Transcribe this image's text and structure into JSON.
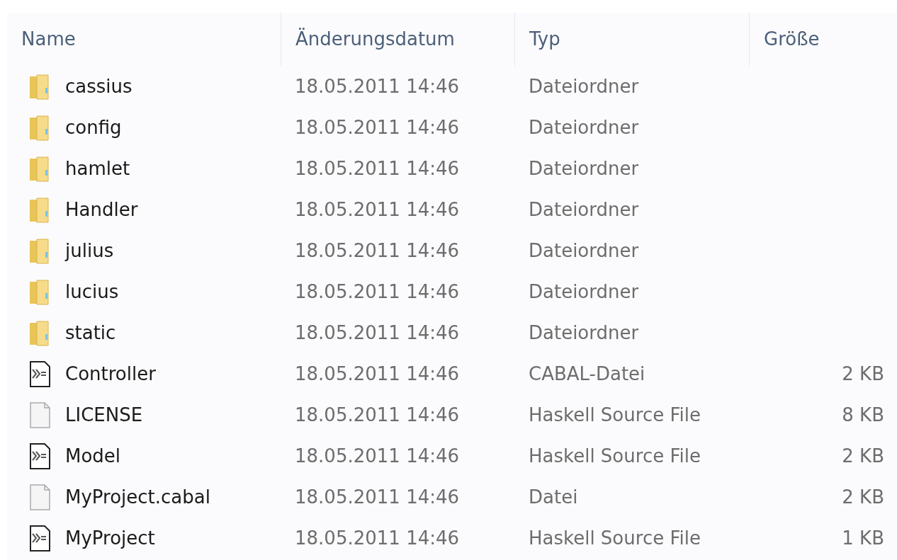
{
  "columns": [
    "Name",
    "Änderungsdatum",
    "Typ",
    "Größe"
  ],
  "rows": [
    {
      "kind": "folder",
      "name": "cassius",
      "date": "18.05.2011 14:46",
      "type": "Dateiordner"
    },
    {
      "kind": "folder",
      "name": "config",
      "date": "18.05.2011 14:46",
      "type": "Dateiordner"
    },
    {
      "kind": "folder",
      "name": "hamlet",
      "date": "18.05.2011 14:46",
      "type": "Dateiordner"
    },
    {
      "kind": "folder",
      "name": "Handler",
      "date": "18.05.2011 14:46",
      "type": "Dateiordner"
    },
    {
      "kind": "folder",
      "name": "julius",
      "date": "18.05.2011 14:46",
      "type": "Dateiordner"
    },
    {
      "kind": "folder",
      "name": "lucius",
      "date": "18.05.2011 14:46",
      "type": "Dateiordner"
    },
    {
      "kind": "folder",
      "name": "static",
      "date": "18.05.2011 14:46",
      "type": "Dateiordner"
    },
    {
      "kind": "haskell",
      "name": "Controller",
      "date": "18.05.2011 14:46",
      "type": "CABAL-Datei",
      "size": "2 KB"
    },
    {
      "kind": "plain",
      "name": "LICENSE",
      "date": "18.05.2011 14:46",
      "type": "Haskell Source File",
      "size": "8 KB"
    },
    {
      "kind": "haskell",
      "name": "Model",
      "date": "18.05.2011 14:46",
      "type": "Haskell Source File",
      "size": "2 KB"
    },
    {
      "kind": "plain",
      "name": "MyProject.cabal",
      "date": "18.05.2011 14:46",
      "type": "Datei",
      "size": "2 KB"
    },
    {
      "kind": "haskell",
      "name": "MyProject",
      "date": "18.05.2011 14:46",
      "type": "Haskell Source File",
      "size": "1 KB"
    }
  ]
}
